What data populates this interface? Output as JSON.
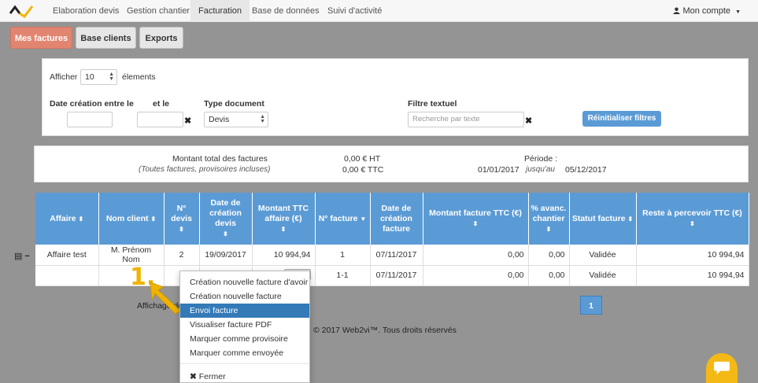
{
  "nav": {
    "items": [
      "Elaboration devis",
      "Gestion chantier",
      "Facturation",
      "Base de données",
      "Suivi d'activité"
    ],
    "account": "Mon compte"
  },
  "subnav": {
    "invoices": "Mes factures",
    "clients": "Base clients",
    "exports": "Exports"
  },
  "filters": {
    "show_label": "Afficher",
    "show_value": "10",
    "elements_label": "élements",
    "date_from_label": "Date création entre le",
    "date_to_label": "et le",
    "doc_type_label": "Type document",
    "doc_type_value": "Devis",
    "text_filter_label": "Filtre textuel",
    "text_filter_placeholder": "Recherche par texte",
    "reset_label": "Réinitialiser filtres"
  },
  "summary": {
    "total_label": "Montant total des factures",
    "total_sub": "(Toutes factures, provisoires incluses)",
    "ht": "0,00 € HT",
    "ttc": "0,00 € TTC",
    "period_label": "Période :",
    "date_start": "01/01/2017",
    "until": "jusqu'au",
    "date_end": "05/12/2017"
  },
  "table": {
    "headers": [
      "Affaire",
      "Nom client",
      "N° devis",
      "Date de création devis",
      "Montant TTC affaire (€)",
      "N° facture",
      "Date de création facture",
      "Montant facture TTC (€)",
      "% avanc. chantier",
      "Statut facture",
      "Reste à percevoir TTC (€)"
    ],
    "rows": [
      [
        "Affaire test",
        "M. Prénom Nom",
        "2",
        "19/09/2017",
        "10 994,94",
        "1",
        "07/11/2017",
        "0,00",
        "0,00",
        "Validée",
        "10 994,94"
      ],
      [
        "",
        "",
        "",
        "",
        "",
        "1-1",
        "07/11/2017",
        "0,00",
        "0,00",
        "Validée",
        "10 994,94"
      ]
    ]
  },
  "dropdown": {
    "items": [
      "Création nouvelle facture d'avoir",
      "Création nouvelle facture",
      "Envoi facture",
      "Visualiser facture PDF",
      "Marquer comme provisoire",
      "Marquer comme envoyée"
    ],
    "close": "Fermer",
    "active_index": 2
  },
  "annotation": {
    "step": "1."
  },
  "pagination": {
    "page": "1"
  },
  "showing": "Affichage de",
  "footer": "© 2017 Web2vi™. Tous droits réservés",
  "colors": {
    "primary": "#5b9bd5",
    "accent": "#e28570",
    "highlight": "#f0b400",
    "chat": "#f5b916"
  }
}
